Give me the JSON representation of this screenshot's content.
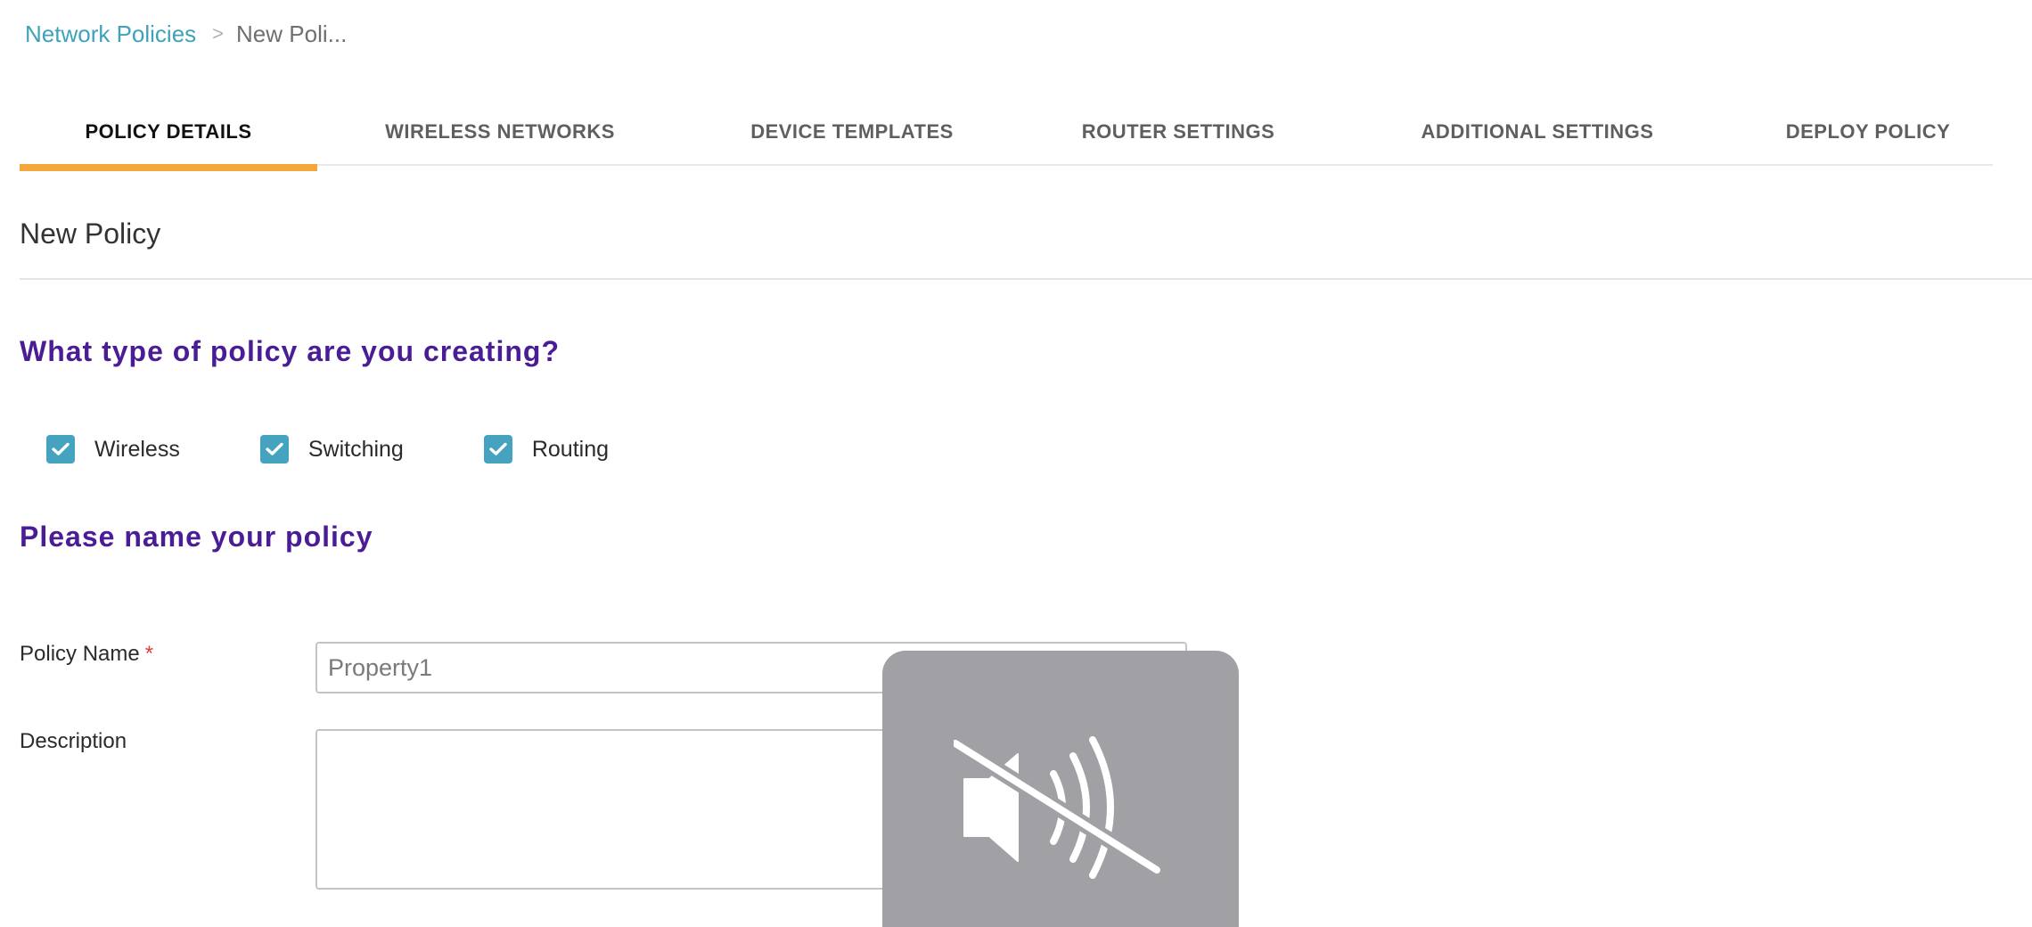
{
  "breadcrumb": {
    "parent": "Network Policies",
    "separator": ">",
    "current": "New Poli..."
  },
  "tabs": [
    {
      "label": "POLICY DETAILS",
      "active": true
    },
    {
      "label": "WIRELESS NETWORKS",
      "active": false
    },
    {
      "label": "DEVICE TEMPLATES",
      "active": false
    },
    {
      "label": "ROUTER SETTINGS",
      "active": false
    },
    {
      "label": "ADDITIONAL SETTINGS",
      "active": false
    },
    {
      "label": "DEPLOY POLICY",
      "active": false
    }
  ],
  "page_title": "New Policy",
  "policy_type": {
    "heading": "What type of policy are you creating?",
    "options": [
      {
        "label": "Wireless",
        "checked": true
      },
      {
        "label": "Switching",
        "checked": true
      },
      {
        "label": "Routing",
        "checked": true
      }
    ]
  },
  "policy_name_section": {
    "heading": "Please name your policy",
    "name_label": "Policy Name",
    "required_marker": "*",
    "name_value": "Property1",
    "description_label": "Description",
    "description_value": ""
  },
  "overlay": {
    "icon": "speaker-muted-icon"
  },
  "colors": {
    "accent_tab": "#f5a63a",
    "link": "#3ea2ba",
    "heading": "#4a1d96",
    "checkbox": "#46a3bf",
    "required": "#e03b3b",
    "overlay": "#a1a0a5"
  }
}
